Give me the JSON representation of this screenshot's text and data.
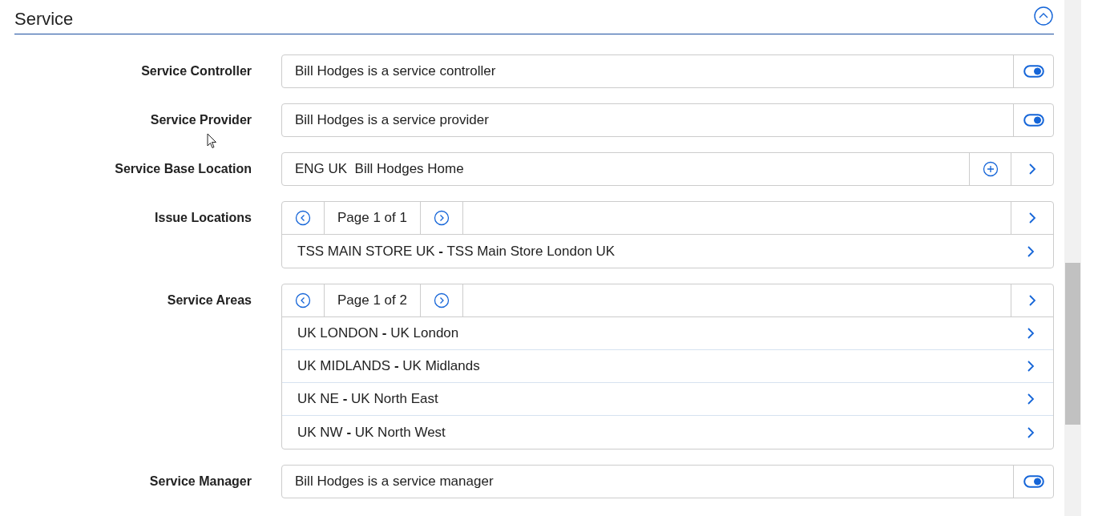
{
  "section": {
    "title": "Service",
    "expanded": true
  },
  "fields": [
    {
      "kind": "toggle",
      "label": "Service Controller",
      "value": "Bill Hodges is a service controller",
      "on": true
    },
    {
      "kind": "toggle",
      "label": "Service Provider",
      "value": "Bill Hodges is a service provider",
      "on": true
    },
    {
      "kind": "lookup",
      "label": "Service Base Location",
      "value": "ENG UK  Bill Hodges Home"
    },
    {
      "kind": "list",
      "label": "Issue Locations",
      "page": "Page 1 of 1",
      "items": [
        "TSS MAIN STORE UK **-** TSS Main Store London UK"
      ]
    },
    {
      "kind": "list",
      "label": "Service Areas",
      "page": "Page 1 of 2",
      "items": [
        "UK LONDON **-** UK London",
        "UK MIDLANDS **-** UK Midlands",
        "UK NE **-** UK North East",
        "UK NW **-** UK North West"
      ]
    },
    {
      "kind": "toggle",
      "label": "Service Manager",
      "value": "Bill Hodges is a service manager",
      "on": true
    }
  ]
}
